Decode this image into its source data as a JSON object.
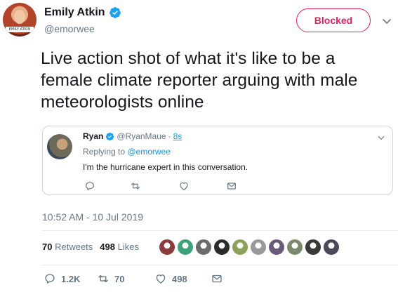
{
  "tweet": {
    "author": {
      "display_name": "Emily Atkin",
      "handle": "@emorwee",
      "avatar_caption": "EMILY ATKIN"
    },
    "follow_button_label": "Blocked",
    "text": "Live action shot of what it's like to be a female climate reporter arguing with male meteorologists online",
    "timestamp": "10:52 AM - 10 Jul 2019"
  },
  "quoted_tweet": {
    "display_name": "Ryan",
    "handle": "@RyanMaue",
    "separator": "·",
    "time": "8s",
    "replying_prefix": "Replying to ",
    "replying_to": "@emorwee",
    "text": "I'm the hurricane expert in this conversation."
  },
  "stats": {
    "retweets_count": "70",
    "retweets_label": "Retweets",
    "likes_count": "498",
    "likes_label": "Likes",
    "liker_avatar_colors": [
      "#8a3b3b",
      "#3fa37a",
      "#6b6b6b",
      "#2b2b2b",
      "#8aa25a",
      "#9a9a9a",
      "#6a5a7a",
      "#7a8a6a",
      "#3a3a3a",
      "#4a4a5a"
    ]
  },
  "actions": {
    "reply_count": "1.2K",
    "retweet_count": "70",
    "like_count": "498"
  },
  "colors": {
    "accent": "#1da1f2",
    "blocked": "#e0245e",
    "muted": "#657786",
    "border": "#ccd6dd"
  }
}
